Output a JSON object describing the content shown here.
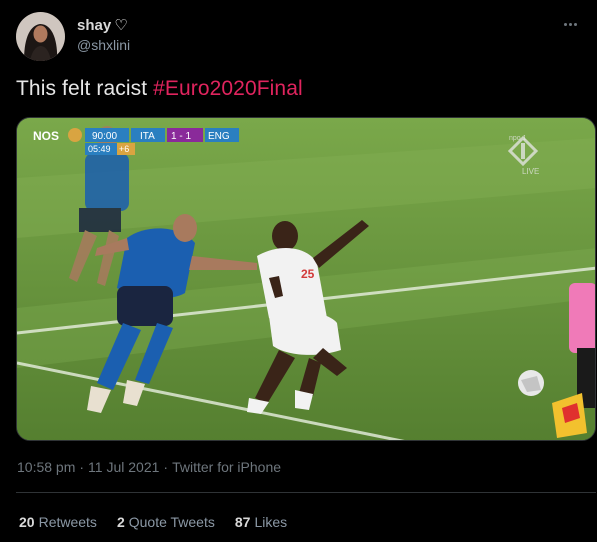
{
  "user": {
    "display_name": "shay",
    "name_emoji": "♡",
    "handle": "@shxlini"
  },
  "tweet": {
    "text": "This felt racist",
    "hashtag": "#Euro2020Final"
  },
  "media": {
    "broadcaster": "NOS",
    "clock": "90:00",
    "team_home": "ITA",
    "score": "1 - 1",
    "team_away": "ENG",
    "extra_time": "05:49",
    "added_time": "+6",
    "channel": "npo 1",
    "live_label": "LIVE",
    "player_number": "25"
  },
  "meta": {
    "time": "10:58 pm",
    "date": "11 Jul 2021",
    "client": "Twitter for iPhone"
  },
  "stats": {
    "retweets_count": "20",
    "retweets_label": "Retweets",
    "quotes_count": "2",
    "quotes_label": "Quote Tweets",
    "likes_count": "87",
    "likes_label": "Likes"
  },
  "colors": {
    "background": "#000000",
    "hashtag": "#e0245e",
    "secondary_text": "#6e767d",
    "italy_blue": "#1b5fb0",
    "england_white": "#f2f2f2",
    "pitch_green": "#6a9a3e"
  },
  "icons": {
    "more": "more-horizontal-icon",
    "heart": "white-heart-icon"
  }
}
